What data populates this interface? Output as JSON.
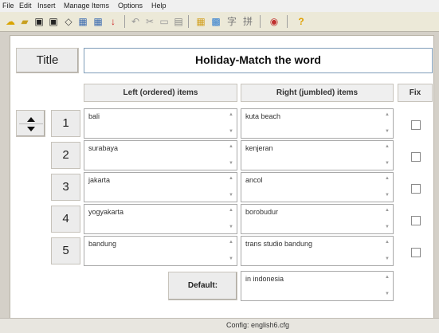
{
  "menu": {
    "file": "File",
    "edit": "Edit",
    "insert": "Insert",
    "manage_items": "Manage Items",
    "options": "Options",
    "help": "Help"
  },
  "toolbar": {
    "icons": [
      "new-icon",
      "open-icon",
      "save-icon",
      "save-as-icon",
      "eraser-icon",
      "grid-icon",
      "grid2-icon",
      "arrow-down-icon",
      "undo-icon",
      "cut-icon",
      "copy-icon",
      "paste-icon",
      "table-icon",
      "export-icon",
      "chinese-icon",
      "pinyin-icon",
      "preview-icon",
      "help-icon"
    ]
  },
  "title_label": "Title",
  "title_value": "Holiday-Match the word",
  "headers": {
    "left": "Left (ordered) items",
    "right": "Right (jumbled) items",
    "fix": "Fix"
  },
  "rows": [
    {
      "num": "1",
      "left": "bali",
      "right": "kuta beach"
    },
    {
      "num": "2",
      "left": "surabaya",
      "right": "kenjeran"
    },
    {
      "num": "3",
      "left": "jakarta",
      "right": "ancol"
    },
    {
      "num": "4",
      "left": "yogyakarta",
      "right": "borobudur"
    },
    {
      "num": "5",
      "left": "bandung",
      "right": "trans studio bandung"
    }
  ],
  "default_label": "Default:",
  "default_value": "in indonesia",
  "status": "Config: english6.cfg"
}
